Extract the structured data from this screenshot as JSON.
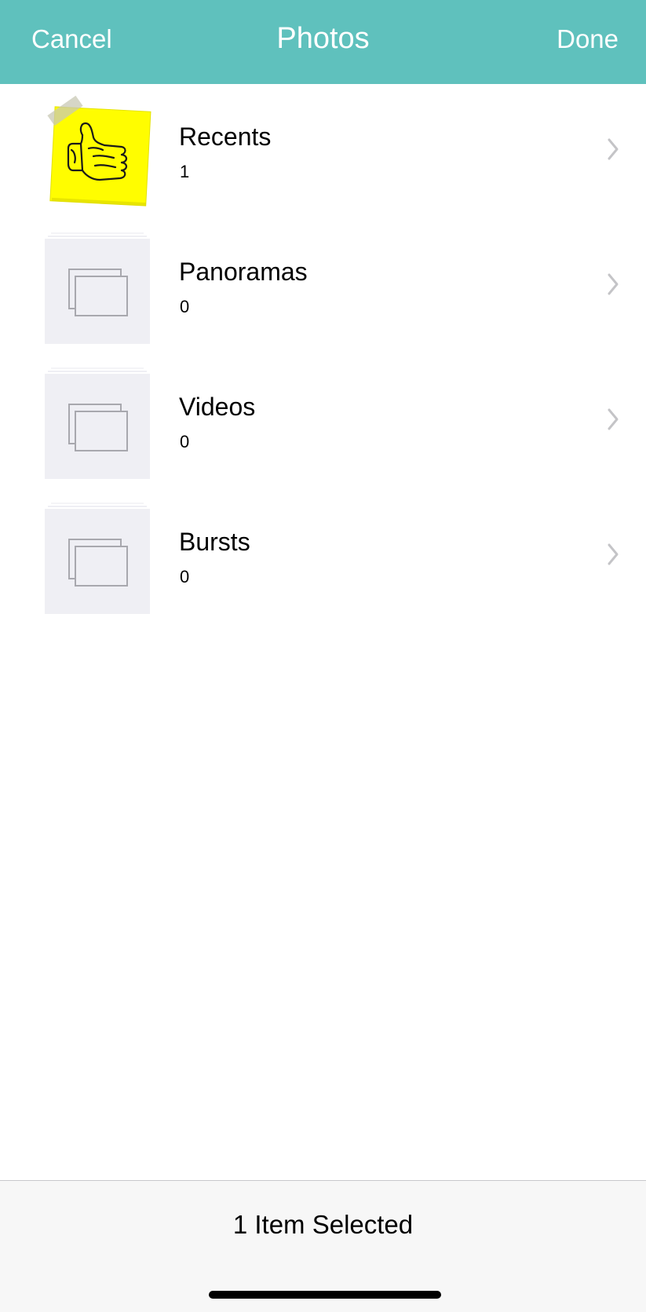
{
  "navbar": {
    "cancel_label": "Cancel",
    "title": "Photos",
    "done_label": "Done",
    "background_color": "#5fc1bd"
  },
  "albums": [
    {
      "title": "Recents",
      "count": "1",
      "thumbnail": "thumbs-up-sticky-note"
    },
    {
      "title": "Panoramas",
      "count": "0",
      "thumbnail": "empty-album-icon"
    },
    {
      "title": "Videos",
      "count": "0",
      "thumbnail": "empty-album-icon"
    },
    {
      "title": "Bursts",
      "count": "0",
      "thumbnail": "empty-album-icon"
    }
  ],
  "footer": {
    "selected_label": "1 Item Selected"
  }
}
